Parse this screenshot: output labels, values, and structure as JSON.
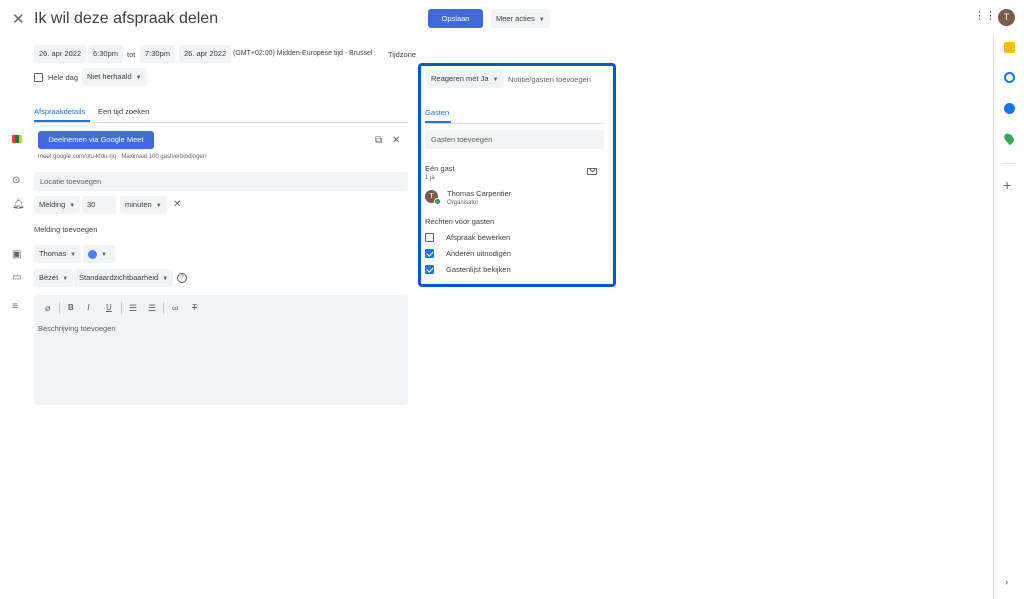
{
  "header": {
    "title": "Ik wil deze afspraak delen",
    "save_label": "Opslaan",
    "more_actions_label": "Meer acties",
    "avatar_letter": "T"
  },
  "datetime": {
    "start_date": "26. apr 2022",
    "start_time": "6:30pm",
    "to_label": "tot",
    "end_time": "7:30pm",
    "end_date": "26. apr 2022",
    "timezone_text": "(GMT+02:00) Midden-Europese tijd - Brussel",
    "timezone_link": "Tijdzone",
    "all_day_label": "Hele dag",
    "repeat_label": "Niet herhaald"
  },
  "tabs": {
    "details_label": "Afspraakdetails",
    "find_time_label": "Een tijd zoeken"
  },
  "meet": {
    "button_label": "Deelnemen via Google Meet",
    "link_text": "meet.google.com/otu-kfdu-rjq · Maximaal 100 gastverbindingen"
  },
  "location": {
    "placeholder": "Locatie toevoegen"
  },
  "notification": {
    "type": "Melding",
    "amount": "30",
    "unit": "minuten",
    "add_label": "Melding toevoegen"
  },
  "calendar": {
    "owner": "Thomas",
    "color": "#4285f4"
  },
  "availability": {
    "status": "Bezet",
    "visibility": "Standaardzichtbaarheid"
  },
  "description": {
    "placeholder": "Beschrijving toevoegen"
  },
  "right_panel": {
    "rsvp_label": "Reageren met Ja",
    "note_label": "Notitie/gasten toevoegen",
    "guests_tab": "Gasten",
    "add_guests_placeholder": "Gasten toevoegen",
    "guest_count_title": "Eén gast",
    "guest_count_sub": "1 ja",
    "guest_name": "Thomas Carpentier",
    "guest_role": "Organisator",
    "guest_avatar_letter": "T",
    "permissions_title": "Rechten voor gasten",
    "permissions": [
      {
        "label": "Afspraak bewerken",
        "checked": false
      },
      {
        "label": "Anderen uitnodigen",
        "checked": true
      },
      {
        "label": "Gastenlijst bekijken",
        "checked": true
      }
    ]
  },
  "colors": {
    "accent": "#1a73e8",
    "primary_button": "#3f6ad8",
    "highlight_border": "#0b57d0"
  }
}
